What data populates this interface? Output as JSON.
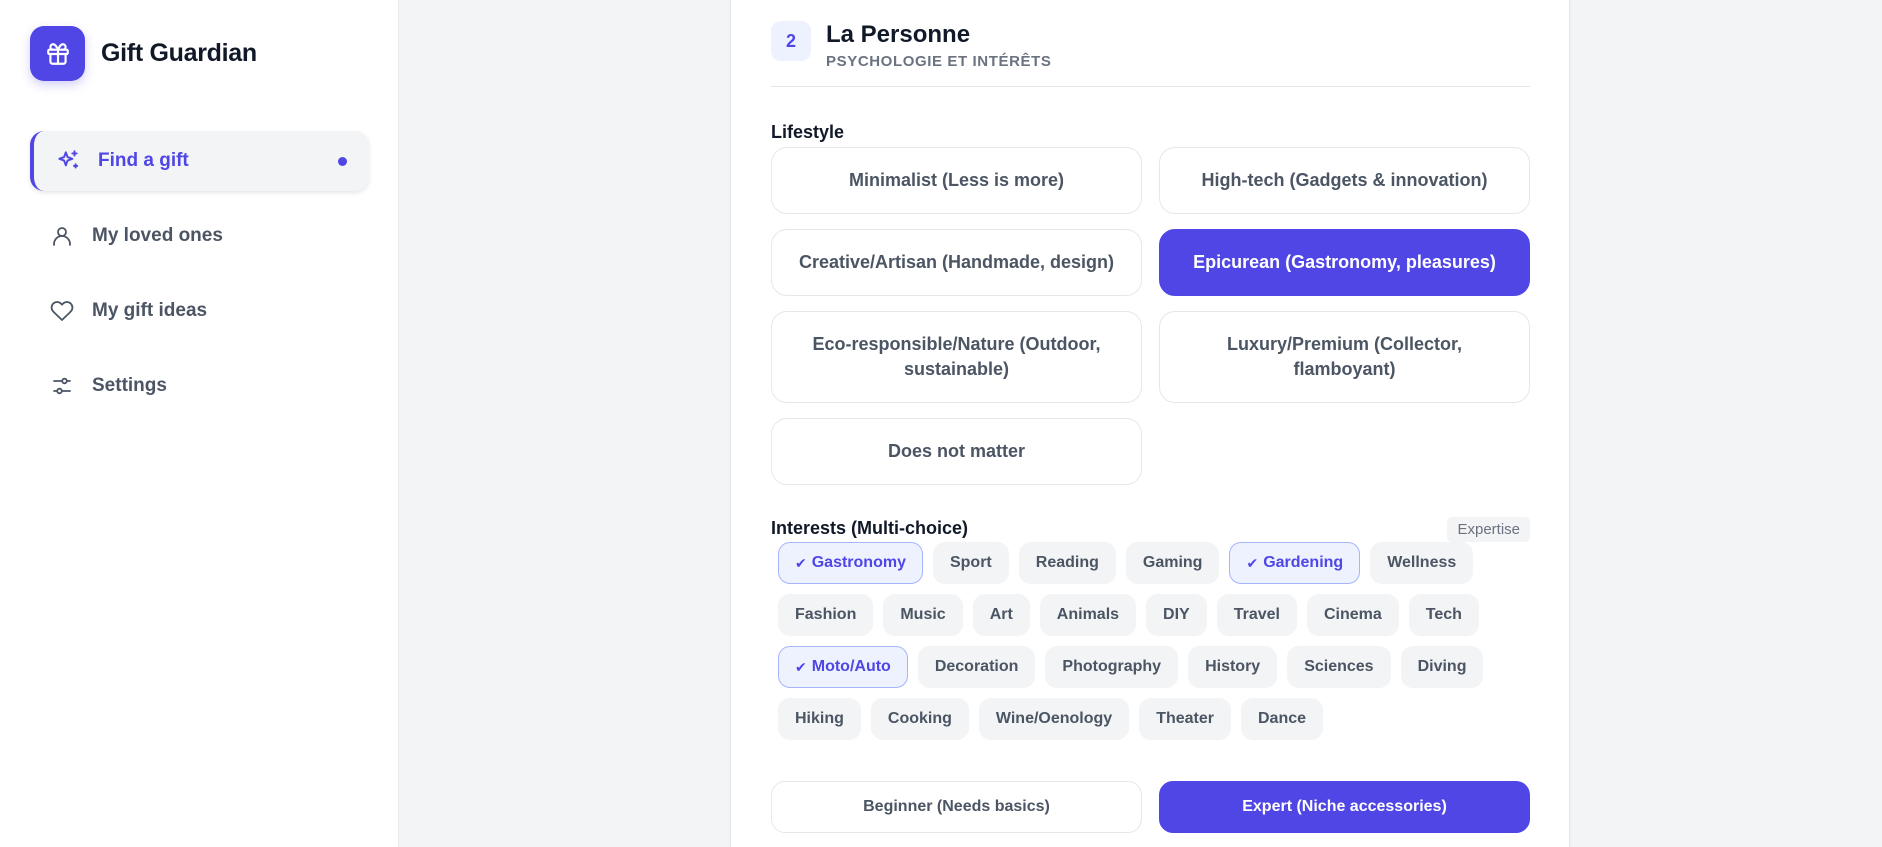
{
  "brand": {
    "name": "Gift Guardian",
    "logo_icon": "gift-icon",
    "color": "#4f46e5"
  },
  "nav": [
    {
      "label": "Find a gift",
      "icon": "sparkles-icon",
      "active": true
    },
    {
      "label": "My loved ones",
      "icon": "user-icon",
      "active": false
    },
    {
      "label": "My gift ideas",
      "icon": "heart-icon",
      "active": false
    },
    {
      "label": "Settings",
      "icon": "sliders-icon",
      "active": false
    }
  ],
  "step": {
    "number": "2",
    "title": "La Personne",
    "subtitle": "PSYCHOLOGIE ET INTÉRÊTS"
  },
  "lifestyle": {
    "label": "Lifestyle",
    "options": [
      {
        "label": "Minimalist (Less is more)",
        "selected": false
      },
      {
        "label": "High-tech (Gadgets & innovation)",
        "selected": false
      },
      {
        "label": "Creative/Artisan (Handmade, design)",
        "selected": false
      },
      {
        "label": "Epicurean (Gastronomy, pleasures)",
        "selected": true
      },
      {
        "label": "Eco-responsible/Nature (Outdoor, sustainable)",
        "selected": false
      },
      {
        "label": "Luxury/Premium (Collector, flamboyant)",
        "selected": false
      },
      {
        "label": "Does not matter",
        "selected": false
      }
    ]
  },
  "interests": {
    "label": "Interests (Multi-choice)",
    "badge": "Expertise",
    "check_glyph": "✔",
    "chips": [
      {
        "label": "Gastronomy",
        "selected": true
      },
      {
        "label": "Sport",
        "selected": false
      },
      {
        "label": "Reading",
        "selected": false
      },
      {
        "label": "Gaming",
        "selected": false
      },
      {
        "label": "Gardening",
        "selected": true
      },
      {
        "label": "Wellness",
        "selected": false
      },
      {
        "label": "Fashion",
        "selected": false
      },
      {
        "label": "Music",
        "selected": false
      },
      {
        "label": "Art",
        "selected": false
      },
      {
        "label": "Animals",
        "selected": false
      },
      {
        "label": "DIY",
        "selected": false
      },
      {
        "label": "Travel",
        "selected": false
      },
      {
        "label": "Cinema",
        "selected": false
      },
      {
        "label": "Tech",
        "selected": false
      },
      {
        "label": "Moto/Auto",
        "selected": true
      },
      {
        "label": "Decoration",
        "selected": false
      },
      {
        "label": "Photography",
        "selected": false
      },
      {
        "label": "History",
        "selected": false
      },
      {
        "label": "Sciences",
        "selected": false
      },
      {
        "label": "Diving",
        "selected": false
      },
      {
        "label": "Hiking",
        "selected": false
      },
      {
        "label": "Cooking",
        "selected": false
      },
      {
        "label": "Wine/Oenology",
        "selected": false
      },
      {
        "label": "Theater",
        "selected": false
      },
      {
        "label": "Dance",
        "selected": false
      }
    ]
  },
  "expertise": {
    "options": [
      {
        "label": "Beginner (Needs basics)",
        "selected": false
      },
      {
        "label": "Expert (Niche accessories)",
        "selected": true
      }
    ]
  }
}
